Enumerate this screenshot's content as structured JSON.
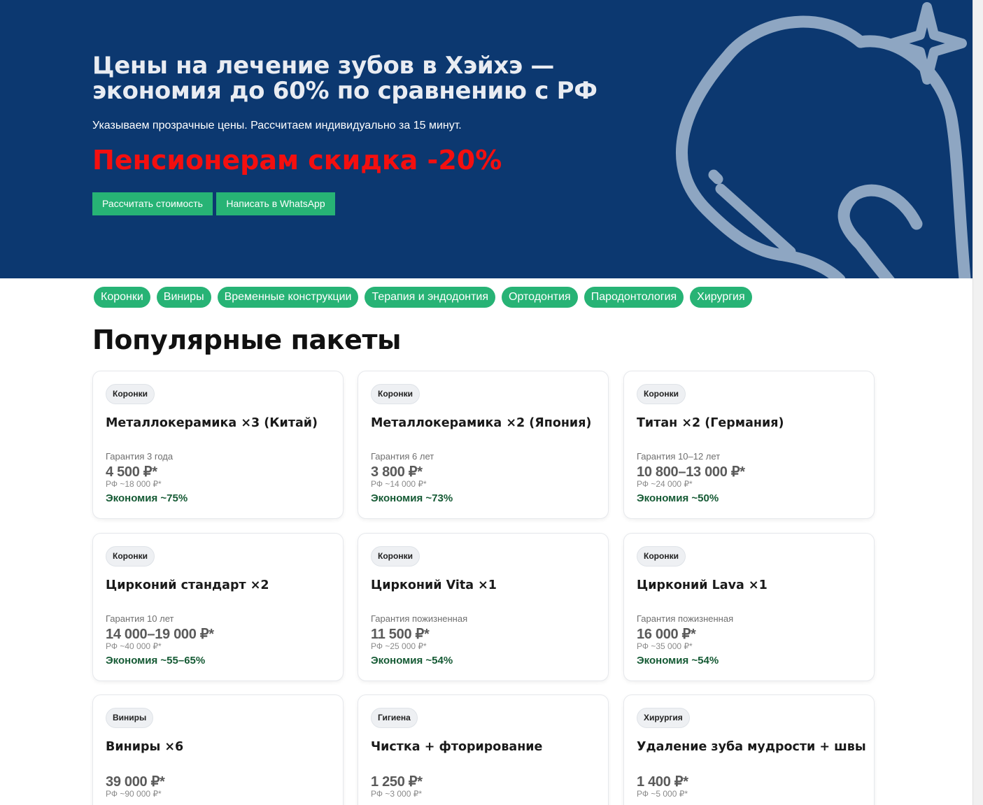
{
  "hero": {
    "title_line1": "Цены на лечение зубов в Хэйхэ —",
    "title_line2": "экономия до 60% по сравнению с РФ",
    "subtitle": "Указываем прозрачные цены. Рассчитаем индивидуально за 15 минут.",
    "discount": "Пенсионерам скидка -20%",
    "buttons": {
      "calc": "Рассчитать стоимость",
      "whatsapp": "Написать в WhatsApp"
    },
    "colors": {
      "background": "#0c3870",
      "discount": "#f40f0f",
      "button": "#27b375"
    },
    "decor_icon": "tooth-sparkle-icon"
  },
  "categories": [
    "Коронки",
    "Виниры",
    "Временные конструкции",
    "Терапия и эндодонтия",
    "Ортодонтия",
    "Пародонтология",
    "Хирургия"
  ],
  "section_title": "Популярные пакеты",
  "cards": [
    {
      "tag": "Коронки",
      "title": "Металлокерамика ×3 (Китай)",
      "warranty": "Гарантия 3 года",
      "price": "4 500 ₽*",
      "rf": "РФ ~18 000 ₽*",
      "save": "Экономия ~75%"
    },
    {
      "tag": "Коронки",
      "title": "Металлокерамика ×2 (Япония)",
      "warranty": "Гарантия 6 лет",
      "price": "3 800 ₽*",
      "rf": "РФ ~14 000 ₽*",
      "save": "Экономия ~73%"
    },
    {
      "tag": "Коронки",
      "title": "Титан ×2 (Германия)",
      "warranty": "Гарантия 10–12 лет",
      "price": "10 800–13 000 ₽*",
      "rf": "РФ ~24 000 ₽*",
      "save": "Экономия ~50%"
    },
    {
      "tag": "Коронки",
      "title": "Цирконий стандарт ×2",
      "warranty": "Гарантия 10 лет",
      "price": "14 000–19 000 ₽*",
      "rf": "РФ ~40 000 ₽*",
      "save": "Экономия ~55–65%"
    },
    {
      "tag": "Коронки",
      "title": "Цирконий Vita ×1",
      "warranty": "Гарантия пожизненная",
      "price": "11 500 ₽*",
      "rf": "РФ ~25 000 ₽*",
      "save": "Экономия ~54%"
    },
    {
      "tag": "Коронки",
      "title": "Цирконий Lava ×1",
      "warranty": "Гарантия пожизненная",
      "price": "16 000 ₽*",
      "rf": "РФ ~35 000 ₽*",
      "save": "Экономия ~54%"
    },
    {
      "tag": "Виниры",
      "title": "Виниры ×6",
      "warranty": "",
      "price": "39 000 ₽*",
      "rf": "РФ ~90 000 ₽*",
      "save": ""
    },
    {
      "tag": "Гигиена",
      "title": "Чистка + фторирование",
      "warranty": "",
      "price": "1 250 ₽*",
      "rf": "РФ ~3 000 ₽*",
      "save": ""
    },
    {
      "tag": "Хирургия",
      "title": "Удаление зуба мудрости + швы",
      "warranty": "",
      "price": "1 400 ₽*",
      "rf": "РФ ~5 000 ₽*",
      "save": ""
    }
  ]
}
